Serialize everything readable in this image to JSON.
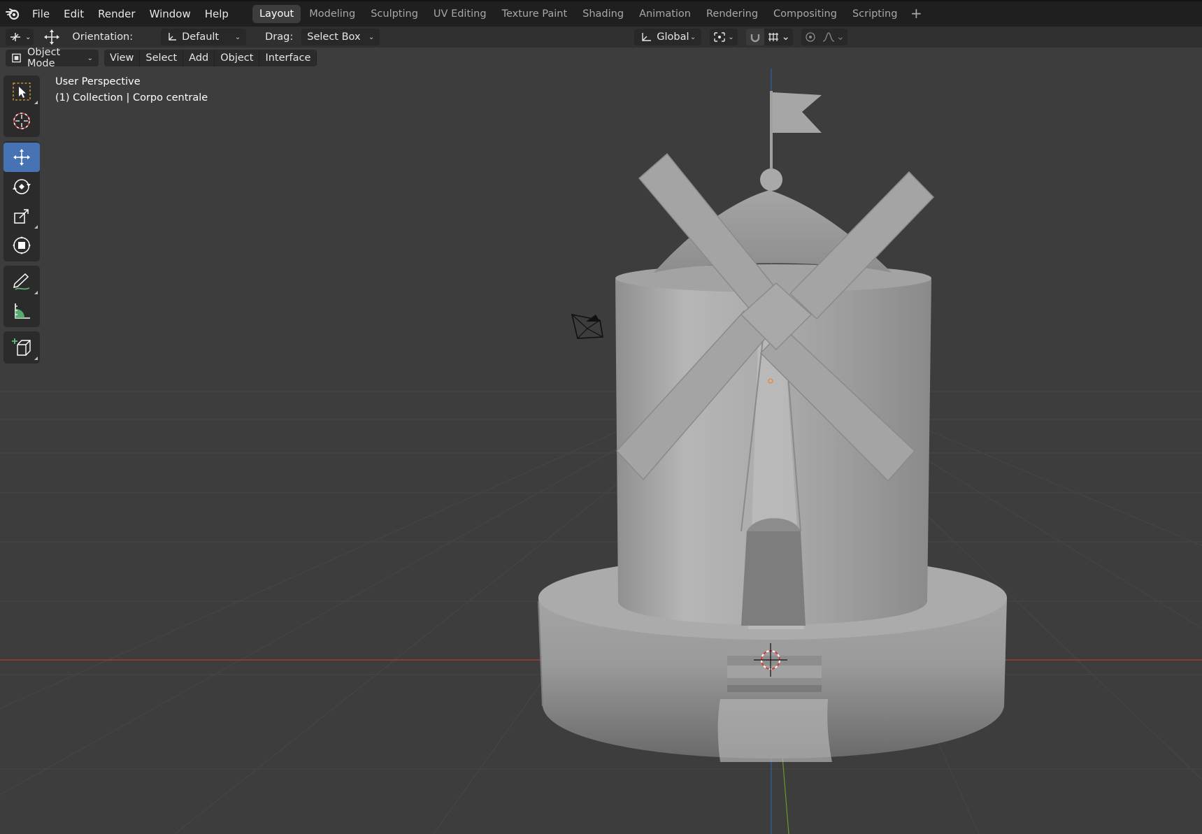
{
  "menu": [
    "File",
    "Edit",
    "Render",
    "Window",
    "Help"
  ],
  "workspaces": [
    "Layout",
    "Modeling",
    "Sculpting",
    "UV Editing",
    "Texture Paint",
    "Shading",
    "Animation",
    "Rendering",
    "Compositing",
    "Scripting"
  ],
  "active_workspace": "Layout",
  "add_workspace": "+",
  "tool_header": {
    "orientation_label": "Orientation:",
    "orientation_value": "Default",
    "drag_label": "Drag:",
    "drag_value": "Select Box",
    "transform_orientation": "Global"
  },
  "viewport_header": {
    "mode": "Object Mode",
    "menus": [
      "View",
      "Select",
      "Add",
      "Object",
      "Interface"
    ]
  },
  "overlay": {
    "view_name": "User Perspective",
    "collection": "(1) Collection | Corpo centrale"
  },
  "tools": [
    {
      "name": "select-box-tool-icon"
    },
    {
      "name": "cursor-tool-icon"
    },
    {
      "name": "move-tool-icon",
      "active": true
    },
    {
      "name": "rotate-tool-icon"
    },
    {
      "name": "scale-tool-icon"
    },
    {
      "name": "transform-tool-icon"
    },
    {
      "name": "annotate-tool-icon"
    },
    {
      "name": "measure-tool-icon"
    },
    {
      "name": "add-cube-tool-icon"
    }
  ],
  "colors": {
    "active_tool": "#4772b3",
    "x_axis": "#b33a3a",
    "y_axis": "#6a9a2a",
    "z_axis": "#2f5fa8",
    "background": "#3d3d3d"
  }
}
